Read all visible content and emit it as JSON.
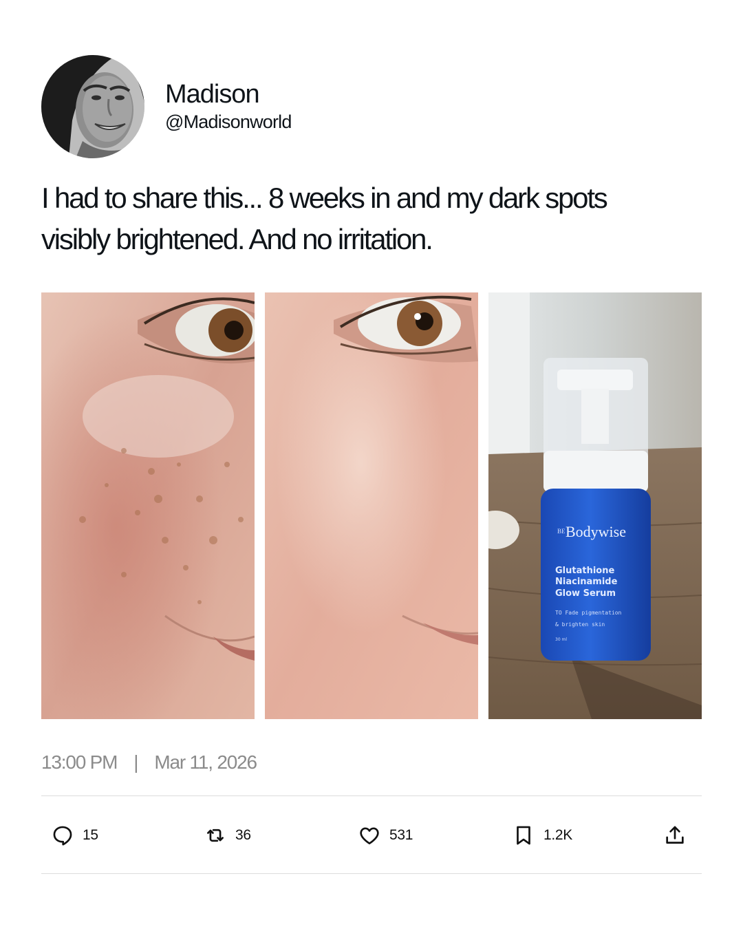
{
  "user": {
    "display_name": "Madison",
    "handle": "@Madisonworld"
  },
  "tweet": {
    "text_line1": "I had to share this... 8 weeks in and my dark spots",
    "text_line2": "visibly brightened. And no irritation."
  },
  "product": {
    "brand_prefix": "BE",
    "brand": "Bodywise",
    "name_line1": "Glutathione",
    "name_line2": "Niacinamide",
    "name_line3": "Glow Serum",
    "desc_line1": "TO Fade pigmentation",
    "desc_line2": "& brighten skin",
    "volume": "30 ml",
    "bottle_color": "#1f56c8"
  },
  "meta": {
    "time": "13:00 PM",
    "separator": "|",
    "date": "Mar 11, 2026"
  },
  "actions": {
    "reply_count": "15",
    "retweet_count": "36",
    "like_count": "531",
    "bookmark_count": "1.2K"
  },
  "icons": [
    "reply-icon",
    "retweet-icon",
    "like-icon",
    "bookmark-icon",
    "share-icon"
  ]
}
